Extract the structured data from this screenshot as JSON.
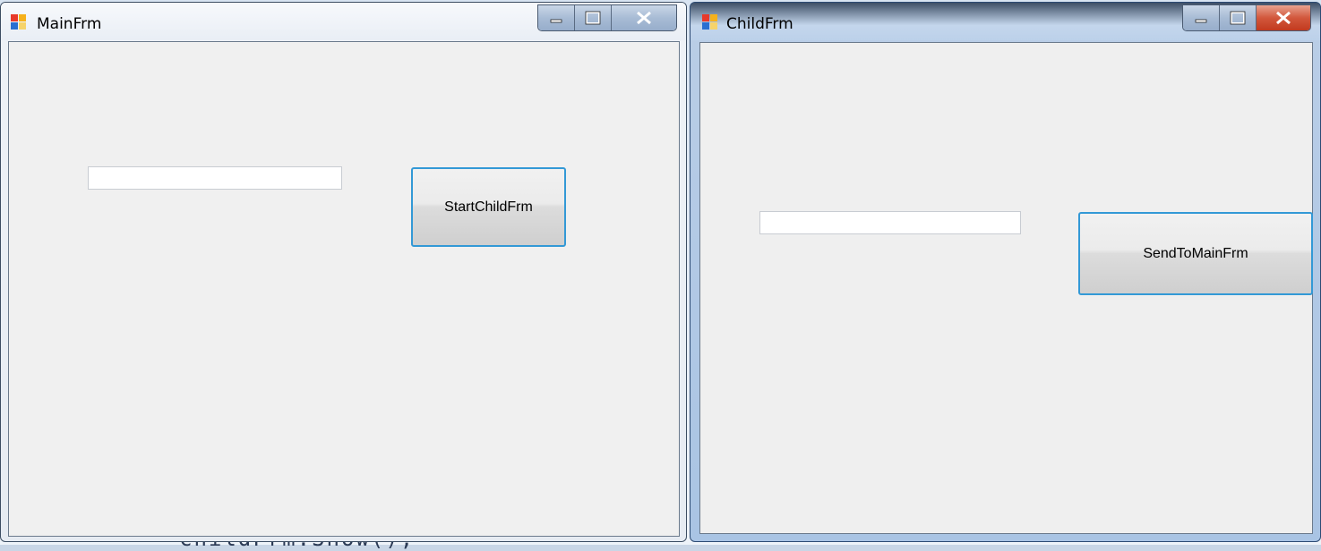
{
  "main_window": {
    "title": "MainFrm",
    "textbox_value": "",
    "button_label": "StartChildFrm"
  },
  "child_window": {
    "title": "ChildFrm",
    "textbox_value": "",
    "button_label": "SendToMainFrm"
  },
  "colors": {
    "button_border": "#3399d6",
    "client_bg": "#f0f0f0",
    "close_button": "#c23a1f"
  }
}
